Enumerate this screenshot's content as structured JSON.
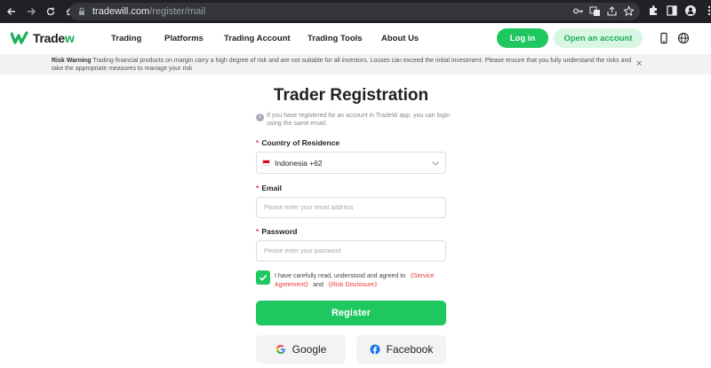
{
  "browser": {
    "url_host": "tradewill.com",
    "url_path": "/register/mail"
  },
  "header": {
    "logo_main": "Trade",
    "logo_accent": "w",
    "nav": [
      "Trading",
      "Platforms",
      "Trading Account",
      "Trading Tools",
      "About Us"
    ],
    "login_label": "Log in",
    "open_account_label": "Open an account"
  },
  "risk": {
    "title": "Risk Warning",
    "text": "Trading financial products on margin carry a high degree of risk and are not suitable for all investors. Losses can exceed the initial investment. Please ensure that you fully understand the risks and take the appropriate measures to manage your risk",
    "close_glyph": "×"
  },
  "form": {
    "title": "Trader Registration",
    "info": "If you have registered for an account in TradeW app, you can login using the same email.",
    "required_mark": "*",
    "country_label": "Country of Residence",
    "country_value": "Indonesia +62",
    "email_label": "Email",
    "email_placeholder": "Please enter your email address",
    "password_label": "Password",
    "password_placeholder": "Please enter your password",
    "agree_text": "I have carefully read, understood and agreed to",
    "service_link": "《Service Agreement》",
    "and_text": "and",
    "risk_link": "《Risk Disclosure》",
    "agree_checked": true,
    "register_label": "Register",
    "google_label": "Google",
    "facebook_label": "Facebook"
  },
  "colors": {
    "brand_green": "#1ec760",
    "light_green": "#d8f6e4",
    "link_red": "#e53935"
  }
}
